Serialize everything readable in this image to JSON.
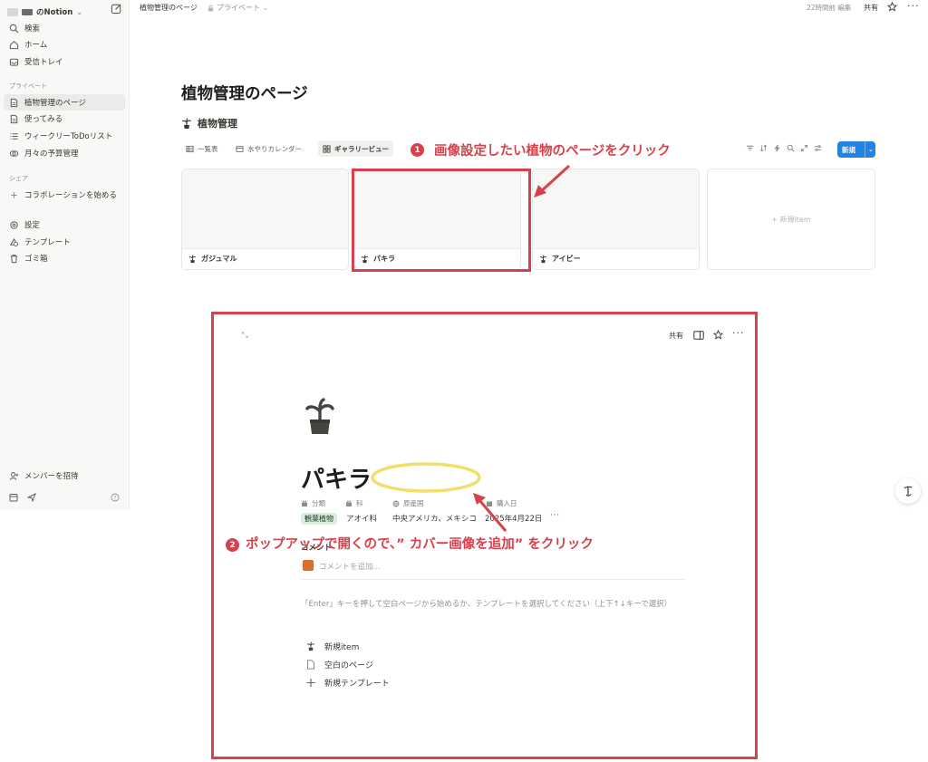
{
  "sidebar": {
    "workspace_name": "のNotion",
    "items_top": [
      {
        "label": "検索",
        "icon": "search-icon"
      },
      {
        "label": "ホーム",
        "icon": "home-icon"
      },
      {
        "label": "受信トレイ",
        "icon": "inbox-icon"
      }
    ],
    "private_section": "プライベート",
    "private_items": [
      {
        "label": "植物管理のページ",
        "icon": "page-icon",
        "active": true
      },
      {
        "label": "使ってみる",
        "icon": "page-icon"
      },
      {
        "label": "ウィークリーToDoリスト",
        "icon": "list-icon"
      },
      {
        "label": "月々の予算管理",
        "icon": "coins-icon"
      }
    ],
    "shared_section": "シェア",
    "shared_items": [
      {
        "label": "コラボレーションを始める",
        "icon": "plus-icon"
      }
    ],
    "bottom_items": [
      {
        "label": "設定",
        "icon": "gear-icon"
      },
      {
        "label": "テンプレート",
        "icon": "template-icon"
      },
      {
        "label": "ゴミ箱",
        "icon": "trash-icon"
      }
    ],
    "invite_label": "メンバーを招待"
  },
  "topbar": {
    "breadcrumb": "植物管理のページ",
    "privacy": "プライベート",
    "edited": "22時間前 編集",
    "share": "共有"
  },
  "page": {
    "title": "植物管理のページ",
    "database_title": "植物管理",
    "tabs": [
      {
        "label": "一覧表",
        "icon": "table-icon"
      },
      {
        "label": "水やりカレンダー",
        "icon": "calendar-icon"
      },
      {
        "label": "ギャラリービュー",
        "icon": "gallery-icon",
        "active": true
      }
    ],
    "new_button": "新規",
    "cards": [
      {
        "name": "ガジュマル"
      },
      {
        "name": "パキラ"
      },
      {
        "name": "アイビー"
      }
    ],
    "new_item_card": "+ 新規item"
  },
  "annotations": {
    "step1_number": "1",
    "step1_text": "画像設定したい植物のページをクリック",
    "step2_number": "2",
    "step2_text": "ポップアップで開くので、” カバー画像を追加” をクリック",
    "accent_color": "#d8404b",
    "highlight_color": "#f4de6a"
  },
  "popup": {
    "share": "共有",
    "title": "パキラ",
    "properties": [
      {
        "name": "分類",
        "value": "観葉植物"
      },
      {
        "name": "科",
        "value": "アオイ科"
      },
      {
        "name": "原産国",
        "value": "中央アメリカ、メキシコ"
      },
      {
        "name": "購入日",
        "value": "2025年4月22日"
      }
    ],
    "more_props": "···",
    "comments_label": "コメント",
    "comment_placeholder": "コメントを追加...",
    "hint": "「Enter」キーを押して空白ページから始めるか、テンプレートを選択してください（上下↑↓キーで選択）",
    "options": [
      {
        "label": "新規item",
        "icon": "plant-icon"
      },
      {
        "label": "空白のページ",
        "icon": "page-icon"
      },
      {
        "label": "新規テンプレート",
        "icon": "plus-icon"
      }
    ]
  }
}
